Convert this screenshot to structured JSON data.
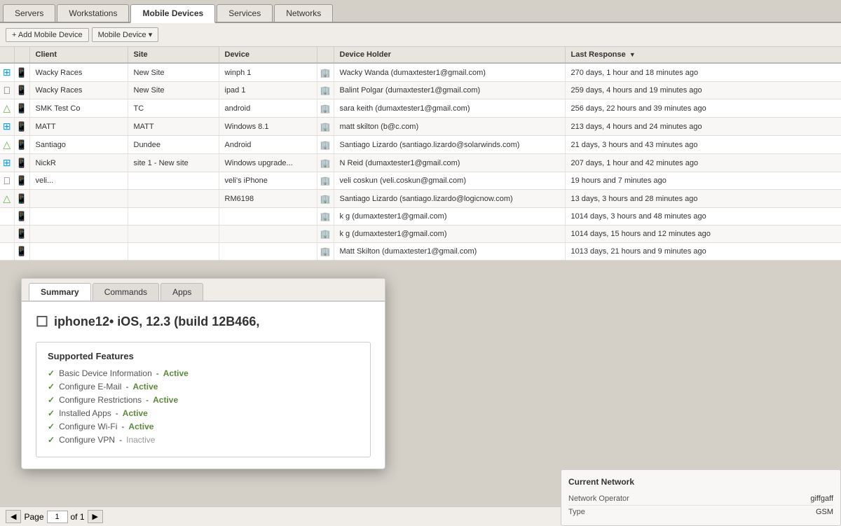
{
  "tabs": {
    "items": [
      {
        "label": "Servers",
        "active": false
      },
      {
        "label": "Workstations",
        "active": false
      },
      {
        "label": "Mobile Devices",
        "active": true
      },
      {
        "label": "Services",
        "active": false
      },
      {
        "label": "Networks",
        "active": false
      }
    ]
  },
  "toolbar": {
    "add_button": "+ Add Mobile Device",
    "device_dropdown": "Mobile Device ▾"
  },
  "table": {
    "headers": [
      "",
      "",
      "Client",
      "Site",
      "Device",
      "",
      "Device Holder",
      "Last Response ▼"
    ],
    "rows": [
      {
        "os": "win",
        "device_type": "phone",
        "client": "Wacky Races",
        "site": "New Site",
        "device": "winph 1",
        "holder": "Wacky Wanda (dumaxtester1@gmail.com)",
        "last_response": "270 days, 1 hour and 18 minutes ago"
      },
      {
        "os": "apple",
        "device_type": "phone",
        "client": "Wacky Races",
        "site": "New Site",
        "device": "ipad 1",
        "holder": "Balint Polgar (dumaxtester1@gmail.com)",
        "last_response": "259 days, 4 hours and 19 minutes ago"
      },
      {
        "os": "android",
        "device_type": "phone",
        "client": "SMK Test Co",
        "site": "TC",
        "device": "android",
        "holder": "sara keith (dumaxtester1@gmail.com)",
        "last_response": "256 days, 22 hours and 39 minutes ago"
      },
      {
        "os": "win",
        "device_type": "phone",
        "client": "MATT",
        "site": "MATT",
        "device": "Windows 8.1",
        "holder": "matt skilton (b@c.com)",
        "last_response": "213 days, 4 hours and 24 minutes ago"
      },
      {
        "os": "android",
        "device_type": "phone",
        "client": "Santiago",
        "site": "Dundee",
        "device": "Android",
        "holder": "Santiago Lizardo (santiago.lizardo@solarwinds.com)",
        "last_response": "21 days, 3 hours and 43 minutes ago"
      },
      {
        "os": "win",
        "device_type": "phone",
        "client": "NickR",
        "site": "site 1 - New site",
        "device": "Windows upgrade...",
        "holder": "N Reid (dumaxtester1@gmail.com)",
        "last_response": "207 days, 1 hour and 42 minutes ago"
      },
      {
        "os": "apple",
        "device_type": "phone",
        "client": "veli...",
        "site": "",
        "device": "veli's iPhone",
        "holder": "veli coskun (veli.coskun@gmail.com)",
        "last_response": "19 hours and 7 minutes ago"
      },
      {
        "os": "android",
        "device_type": "phone",
        "client": "",
        "site": "",
        "device": "RM6198",
        "holder": "Santiago Lizardo (santiago.lizardo@logicnow.com)",
        "last_response": "13 days, 3 hours and 28 minutes ago"
      },
      {
        "os": "",
        "device_type": "phone",
        "client": "",
        "site": "",
        "device": "",
        "holder": "k g (dumaxtester1@gmail.com)",
        "last_response": "1014 days, 3 hours and 48 minutes ago"
      },
      {
        "os": "",
        "device_type": "phone",
        "client": "",
        "site": "",
        "device": "",
        "holder": "k g (dumaxtester1@gmail.com)",
        "last_response": "1014 days, 15 hours and 12 minutes ago"
      },
      {
        "os": "",
        "device_type": "phone",
        "client": "",
        "site": "",
        "device": "",
        "holder": "Matt Skilton (dumaxtester1@gmail.com)",
        "last_response": "1013 days, 21 hours and 9 minutes ago"
      }
    ]
  },
  "pagination": {
    "page_label": "Page",
    "current_page": "1",
    "of_label": "of 1"
  },
  "detail": {
    "tabs": [
      "Summary",
      "Commands",
      "Apps"
    ],
    "active_tab": "Summary",
    "device_name": "iphone12",
    "os": "iOS, 12.3 (build 12B466,",
    "features_title": "Supported Features",
    "features": [
      {
        "label": "Basic Device Information",
        "status": "Active",
        "active": true
      },
      {
        "label": "Configure E-Mail",
        "status": "Active",
        "active": true
      },
      {
        "label": "Configure Restrictions",
        "status": "Active",
        "active": true
      },
      {
        "label": "Installed Apps",
        "status": "Active",
        "active": true
      },
      {
        "label": "Configure Wi-Fi",
        "status": "Active",
        "active": true
      },
      {
        "label": "Configure VPN",
        "status": "Inactive",
        "active": false
      }
    ]
  },
  "network": {
    "title": "Current Network",
    "rows": [
      {
        "label": "Network Operator",
        "value": "giffgaff"
      },
      {
        "label": "Type",
        "value": "GSM"
      }
    ]
  }
}
